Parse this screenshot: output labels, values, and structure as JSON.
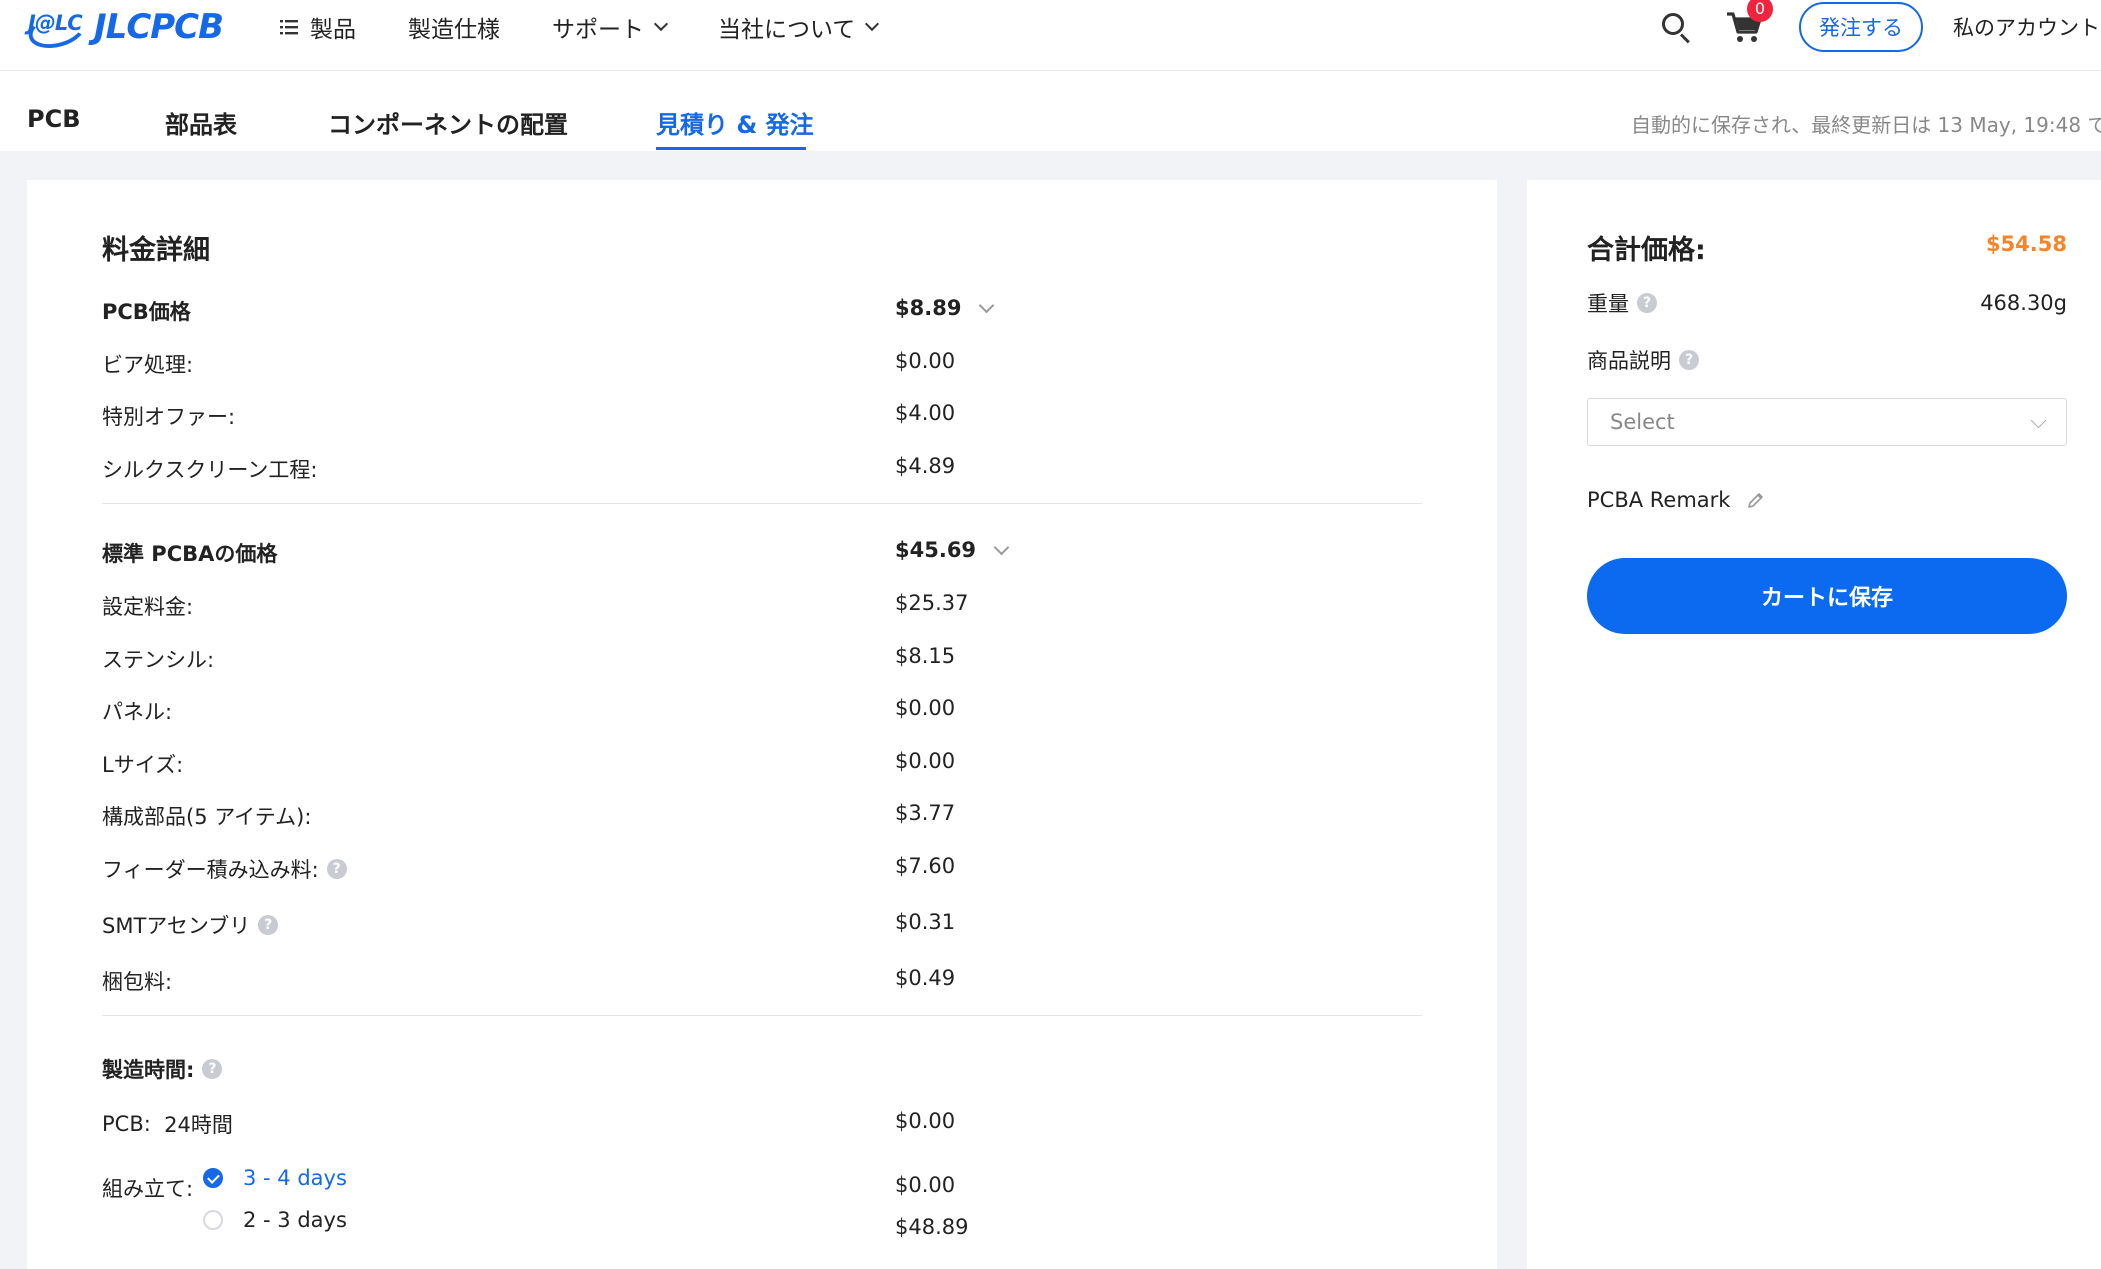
{
  "header": {
    "logo_badge": "J@LC",
    "logo_text": "JLCPCB",
    "nav": [
      {
        "label": "製品",
        "icon": "menu-list-icon",
        "dropdown": false
      },
      {
        "label": "製造仕様",
        "dropdown": false
      },
      {
        "label": "サポート",
        "dropdown": true
      },
      {
        "label": "当社について",
        "dropdown": true
      }
    ],
    "cart_count": "0",
    "order_button": "発注する",
    "account": "私のアカウント"
  },
  "tabs": {
    "items": [
      "PCB",
      "部品表",
      "コンポーネントの配置",
      "見積り & 発注"
    ],
    "active_index": 3,
    "saved_note": "自動的に保存され、最終更新日は 13 May, 19:48 で"
  },
  "cost_details": {
    "title": "料金詳細",
    "pcb": {
      "label": "PCB価格",
      "value": "$8.89",
      "rows": [
        {
          "label": "ビア処理:",
          "value": "$0.00"
        },
        {
          "label": "特別オファー:",
          "value": "$4.00"
        },
        {
          "label": "シルクスクリーン工程:",
          "value": "$4.89"
        }
      ]
    },
    "pcba": {
      "label": "標準 PCBAの価格",
      "value": "$45.69",
      "rows": [
        {
          "label": "設定料金:",
          "value": "$25.37",
          "help": false
        },
        {
          "label": "ステンシル:",
          "value": "$8.15",
          "help": false
        },
        {
          "label": "パネル:",
          "value": "$0.00",
          "help": false
        },
        {
          "label": "Lサイズ:",
          "value": "$0.00",
          "help": false
        },
        {
          "label": "構成部品(5 アイテム):",
          "value": "$3.77",
          "help": false
        },
        {
          "label": "フィーダー積み込み料:",
          "value": "$7.60",
          "help": true
        },
        {
          "label": "SMTアセンブリ",
          "value": "$0.31",
          "help": true
        },
        {
          "label": "梱包料:",
          "value": "$0.49",
          "help": false
        }
      ]
    },
    "build_time": {
      "label": "製造時間:",
      "pcb_label": "PCB:",
      "pcb_time": "24時間",
      "pcb_value": "$0.00",
      "assembly_label": "組み立て:",
      "options": [
        {
          "label": "3 - 4 days",
          "value": "$0.00",
          "selected": true
        },
        {
          "label": "2 - 3 days",
          "value": "$48.89",
          "selected": false
        }
      ]
    }
  },
  "summary": {
    "total_label": "合計価格:",
    "total_value": "$54.58",
    "weight_label": "重量",
    "weight_value": "468.30g",
    "description_label": "商品説明",
    "select_placeholder": "Select",
    "remark_label": "PCBA Remark",
    "save_button": "カートに保存"
  },
  "colors": {
    "accent": "#1669e6",
    "price_orange": "#f5852a",
    "badge_red": "#f0243f",
    "button_blue": "#0b6af0"
  }
}
